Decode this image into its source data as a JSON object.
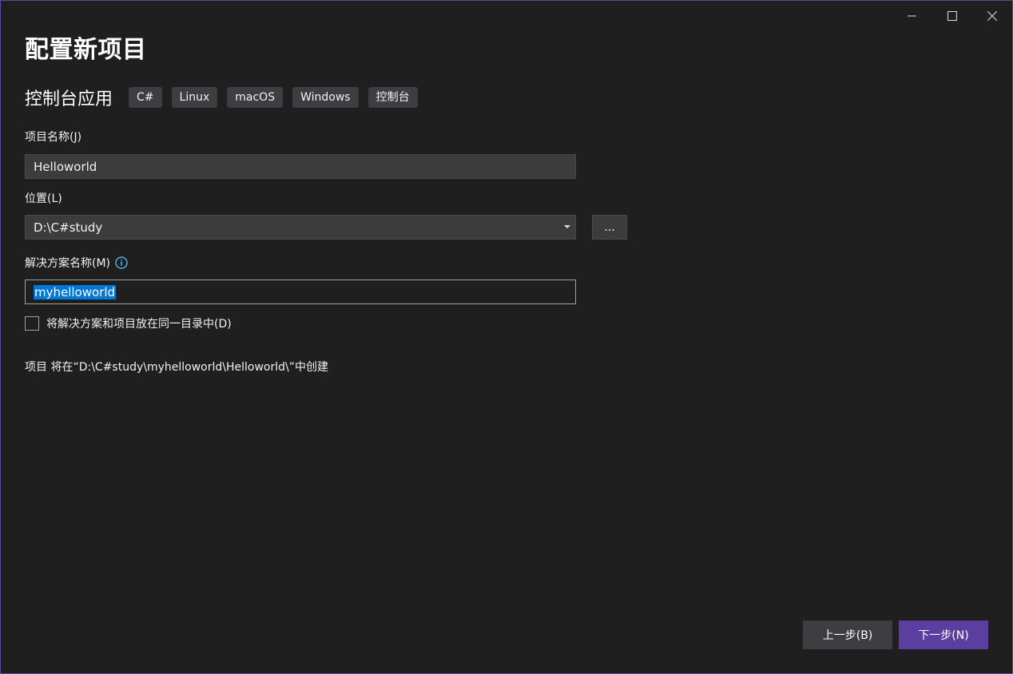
{
  "window": {
    "title": "配置新项目",
    "controls": [
      "minimize-icon",
      "maximize-icon",
      "close-icon"
    ]
  },
  "template": {
    "name": "控制台应用",
    "tags": [
      "C#",
      "Linux",
      "macOS",
      "Windows",
      "控制台"
    ]
  },
  "project_name": {
    "label": "项目名称(J)",
    "value": "Helloworld"
  },
  "location": {
    "label": "位置(L)",
    "value": "D:\\C#study",
    "browse_label": "..."
  },
  "solution_name": {
    "label": "解决方案名称(M)",
    "value": "myhelloworld",
    "info_icon": "info-icon"
  },
  "same_directory": {
    "label": "将解决方案和项目放在同一目录中(D)",
    "checked": false
  },
  "path_note": "项目 将在“D:\\C#study\\myhelloworld\\Helloworld\\”中创建",
  "footer": {
    "back_label": "上一步(B)",
    "next_label": "下一步(N)"
  },
  "colors": {
    "background": "#1f1f1f",
    "accent": "#5b3fa0",
    "selection": "#0078d7",
    "info": "#4fc3f7"
  }
}
